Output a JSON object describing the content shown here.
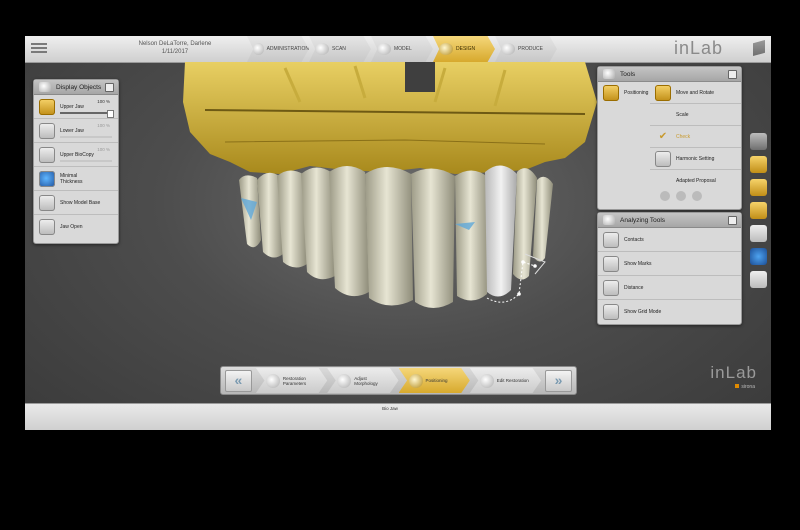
{
  "header": {
    "patient_name": "Nelson DeLaTorre, Darlene",
    "date": "1/11/2017",
    "steps": [
      {
        "label": "ADMINISTRATION",
        "icon": "admin-icon",
        "active": false
      },
      {
        "label": "SCAN",
        "icon": "scan-icon",
        "active": false
      },
      {
        "label": "MODEL",
        "icon": "model-icon",
        "active": false
      },
      {
        "label": "DESIGN",
        "icon": "design-icon",
        "active": true
      },
      {
        "label": "PRODUCE",
        "icon": "produce-icon",
        "active": false
      }
    ],
    "logo": "inLab"
  },
  "display_objects": {
    "title": "Display Objects",
    "items": [
      {
        "label": "Upper Jaw",
        "percent": "100 %",
        "slider": 1.0
      },
      {
        "label": "Lower Jaw",
        "percent": "100 %",
        "slider": 1.0
      },
      {
        "label": "Upper BioCopy",
        "percent": "100 %",
        "slider": 1.0
      },
      {
        "label": "Minimal",
        "label2": "Thickness"
      },
      {
        "label": "Show Model Base"
      },
      {
        "label": "Jaw Open"
      }
    ]
  },
  "tools": {
    "title": "Tools",
    "positioning": "Positioning",
    "items": [
      {
        "label": "Move and Rotate",
        "enabled": true
      },
      {
        "label": "Scale",
        "enabled": true
      },
      {
        "label": "Check",
        "enabled": false
      },
      {
        "label": "Harmonic Setting",
        "enabled": true
      },
      {
        "label": "Adapted Proposal",
        "enabled": true
      }
    ]
  },
  "analyzing_tools": {
    "title": "Analyzing Tools",
    "items": [
      {
        "label": "Contacts"
      },
      {
        "label": "Show Marks"
      },
      {
        "label": "Distance"
      },
      {
        "label": "Show Grid Mode"
      }
    ]
  },
  "workflow": {
    "prev": "«",
    "next": "»",
    "steps": [
      {
        "label": "Restoration",
        "label2": "Parameters",
        "active": false
      },
      {
        "label": "Adjust",
        "label2": "Morphology",
        "active": false
      },
      {
        "label": "Positioning",
        "label2": "",
        "active": true
      },
      {
        "label": "Edit Restoration",
        "label2": "",
        "active": false
      }
    ]
  },
  "watermark": {
    "logo": "inLab",
    "sub": "sirona"
  },
  "bottom": {
    "bio_jaw": "Bio Jaw"
  },
  "colors": {
    "accent": "#d7a92d",
    "gold_model": "#c9a82a",
    "tooth": "#e4e2d0"
  }
}
